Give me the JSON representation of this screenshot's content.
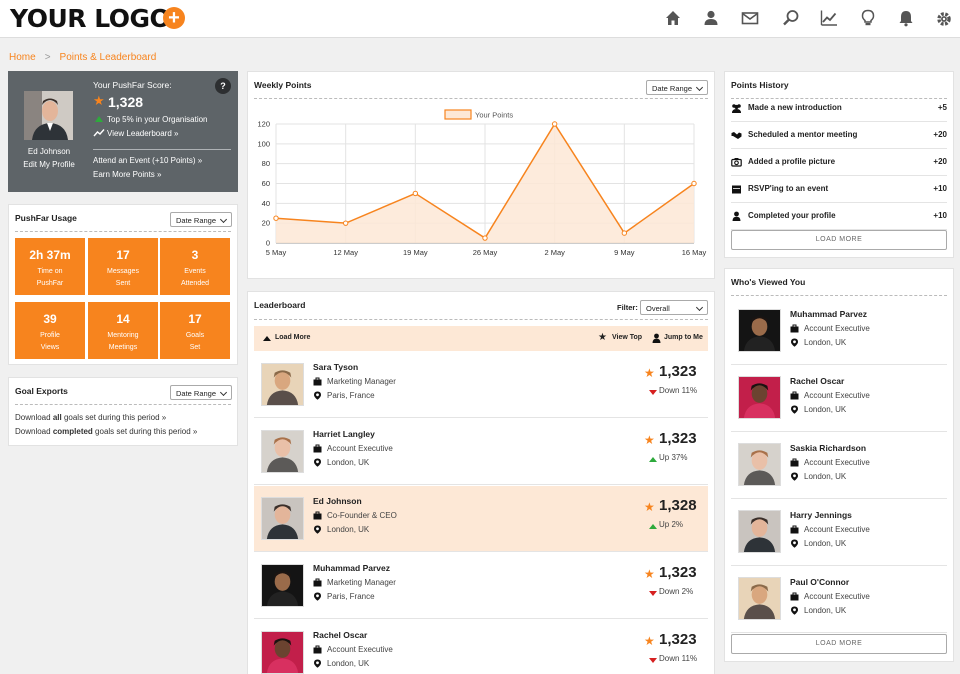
{
  "header": {
    "logo_text": "YOUR LOGO",
    "logo_plus": "+",
    "nav_icons": [
      "home-icon",
      "user-icon",
      "mail-icon",
      "search-icon",
      "trend-icon",
      "lightbulb-icon",
      "bell-icon",
      "gear-icon"
    ]
  },
  "breadcrumb": {
    "home": "Home",
    "separator": ">",
    "current": "Points & Leaderboard"
  },
  "profile": {
    "name": "Ed Johnson",
    "edit_link": "Edit My Profile",
    "score_label": "Your PushFar Score:",
    "score": "1,328",
    "rank_text": "Top 5% in your Organisation",
    "view_leaderboard": "View Leaderboard »",
    "attend_event": "Attend an Event (+10 Points) »",
    "earn_more": "Earn More Points »",
    "help": "?"
  },
  "usage": {
    "title": "PushFar Usage",
    "date_range": "Date Range",
    "tiles": [
      {
        "value": "2h 37m",
        "label1": "Time on",
        "label2": "PushFar"
      },
      {
        "value": "17",
        "label1": "Messages",
        "label2": "Sent"
      },
      {
        "value": "3",
        "label1": "Events",
        "label2": "Attended"
      },
      {
        "value": "39",
        "label1": "Profile",
        "label2": "Views"
      },
      {
        "value": "14",
        "label1": "Mentoring",
        "label2": "Meetings"
      },
      {
        "value": "17",
        "label1": "Goals",
        "label2": "Set"
      }
    ]
  },
  "goal_exports": {
    "title": "Goal Exports",
    "date_range": "Date Range",
    "line1_pre": "Download ",
    "line1_bold": "all",
    "line1_post": " goals set during this period »",
    "line2_pre": "Download ",
    "line2_bold": "completed",
    "line2_post": " goals set during this period »"
  },
  "weekly": {
    "title": "Weekly Points",
    "date_range": "Date Range"
  },
  "chart_data": {
    "type": "area",
    "title": "",
    "legend": "Your Points",
    "x": [
      "5 May",
      "12 May",
      "19 May",
      "26 May",
      "2 May",
      "9 May",
      "16 May"
    ],
    "series": [
      {
        "name": "Your Points",
        "values": [
          25,
          20,
          50,
          5,
          120,
          10,
          60
        ]
      }
    ],
    "y_ticks": [
      0,
      20,
      40,
      60,
      80,
      100,
      120
    ],
    "ylim": [
      0,
      120
    ],
    "grid": true,
    "color": "#f7841e",
    "fill": "#fde8d6"
  },
  "leaderboard": {
    "title": "Leaderboard",
    "filter_label": "Filter:",
    "filter_value": "Overall",
    "load_more": "Load More",
    "view_top": "View Top",
    "jump_to_me": "Jump to Me",
    "rows": [
      {
        "name": "Sara Tyson",
        "role": "Marketing Manager",
        "location": "Paris, France",
        "score": "1,323",
        "trend": "Down 11%",
        "dir": "down",
        "highlight": false
      },
      {
        "name": "Harriet Langley",
        "role": "Account Executive",
        "location": "London, UK",
        "score": "1,323",
        "trend": "Up 37%",
        "dir": "up",
        "highlight": false
      },
      {
        "name": "Ed Johnson",
        "role": "Co-Founder & CEO",
        "location": "London, UK",
        "score": "1,328",
        "trend": "Up 2%",
        "dir": "up",
        "highlight": true
      },
      {
        "name": "Muhammad Parvez",
        "role": "Marketing Manager",
        "location": "Paris, France",
        "score": "1,323",
        "trend": "Down 2%",
        "dir": "down",
        "highlight": false
      },
      {
        "name": "Rachel Oscar",
        "role": "Account Executive",
        "location": "London, UK",
        "score": "1,323",
        "trend": "Down 11%",
        "dir": "down",
        "highlight": false
      }
    ]
  },
  "history": {
    "title": "Points History",
    "items": [
      {
        "label": "Made a new introduction",
        "points": "+5",
        "icon": "people-icon"
      },
      {
        "label": "Scheduled a mentor meeting",
        "points": "+20",
        "icon": "handshake-icon"
      },
      {
        "label": "Added a profile picture",
        "points": "+20",
        "icon": "camera-icon"
      },
      {
        "label": "RSVP'ing to an event",
        "points": "+10",
        "icon": "calendar-icon"
      },
      {
        "label": "Completed your profile",
        "points": "+10",
        "icon": "user-icon"
      }
    ],
    "load_more": "LOAD MORE"
  },
  "viewers": {
    "title": "Who's Viewed You",
    "items": [
      {
        "name": "Muhammad Parvez",
        "role": "Account Executive",
        "location": "London, UK"
      },
      {
        "name": "Rachel Oscar",
        "role": "Account Executive",
        "location": "London, UK"
      },
      {
        "name": "Saskia Richardson",
        "role": "Account Executive",
        "location": "London, UK"
      },
      {
        "name": "Harry Jennings",
        "role": "Account Executive",
        "location": "London, UK"
      },
      {
        "name": "Paul O'Connor",
        "role": "Account Executive",
        "location": "London, UK"
      }
    ],
    "load_more": "LOAD MORE"
  },
  "colors": {
    "accent": "#f7841e",
    "profile_bg": "#5e6468",
    "highlight_bg": "#fde8d6",
    "up": "#2eaa3c",
    "down": "#d62020"
  }
}
